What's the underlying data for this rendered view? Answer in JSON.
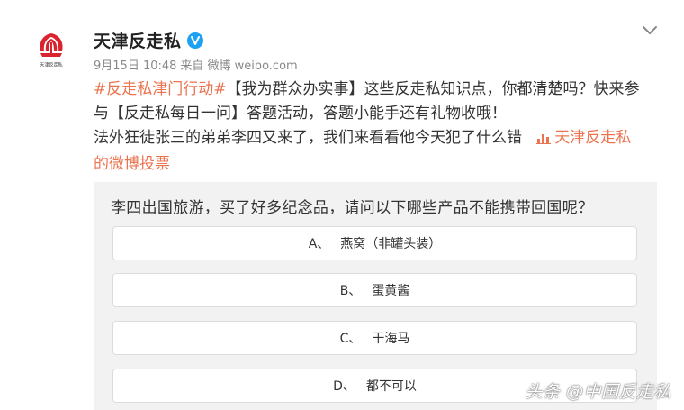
{
  "post": {
    "avatar_caption": "天津反走私",
    "author_name": "天津反走私",
    "date": "9月15日 10:48",
    "source_prefix": "来自",
    "source": "微博 weibo.com",
    "hashtag": "#反走私津门行动#",
    "line1_rest": "【我为群众办实事】这些反走私知识点，你都清楚吗？快来参",
    "line2": "与【反走私每日一问】答题活动，答题小能手还有礼物收哦！",
    "line3": "法外狂徒张三的弟弟李四又来了，我们来看看他今天犯了什么错",
    "poll_link_line1": "天津反走私",
    "poll_link_line2": "的微博投票"
  },
  "poll": {
    "question": "李四出国旅游，买了好多纪念品，请问以下哪些产品不能携带回国呢？",
    "options": [
      {
        "letter": "A、",
        "text": "燕窝（非罐头装）"
      },
      {
        "letter": "B、",
        "text": "蛋黄酱"
      },
      {
        "letter": "C、",
        "text": "干海马"
      },
      {
        "letter": "D、",
        "text": "都不可以"
      }
    ]
  },
  "watermark": "头条 @中国反走私",
  "colors": {
    "link": "#eb7350",
    "verified": "#1da1f2",
    "avatar_red": "#d9232e"
  },
  "icons": [
    "avatar-logo-icon",
    "verified-badge-icon",
    "chevron-down-icon",
    "poll-chart-icon"
  ]
}
